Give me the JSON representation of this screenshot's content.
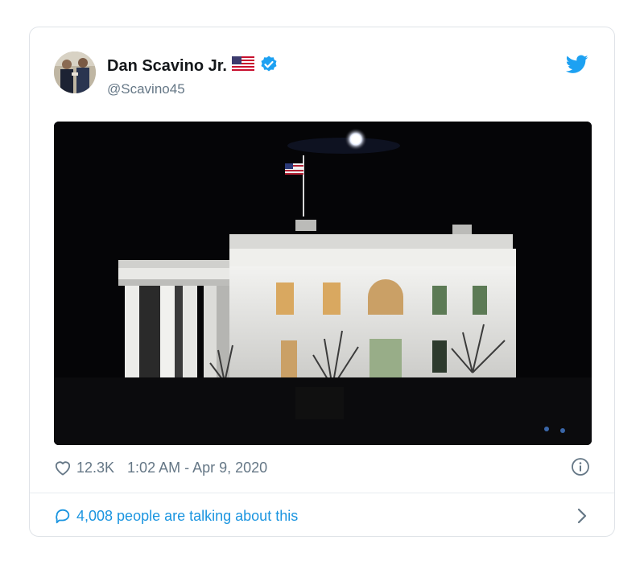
{
  "tweet": {
    "author": {
      "display_name": "Dan Scavino Jr.",
      "flag_emoji": "🇺🇸",
      "handle": "@Scavino45",
      "verified": true
    },
    "media": {
      "subject": "white-house-at-night",
      "alt": "White House lit at night with flag and moon"
    },
    "likes": "12.3K",
    "timestamp": "1:02 AM - Apr 9, 2020",
    "conversation_text": "4,008 people are talking about this"
  },
  "colors": {
    "brand_blue": "#1da1f2",
    "link_blue": "#1b95e0",
    "muted_text": "#657786",
    "border": "#dfe3e8"
  },
  "icons": {
    "brand": "twitter-bird-icon",
    "verified": "verified-badge-icon",
    "like": "heart-icon",
    "info": "info-icon",
    "reply": "speech-bubble-icon",
    "navigate": "chevron-right-icon"
  }
}
